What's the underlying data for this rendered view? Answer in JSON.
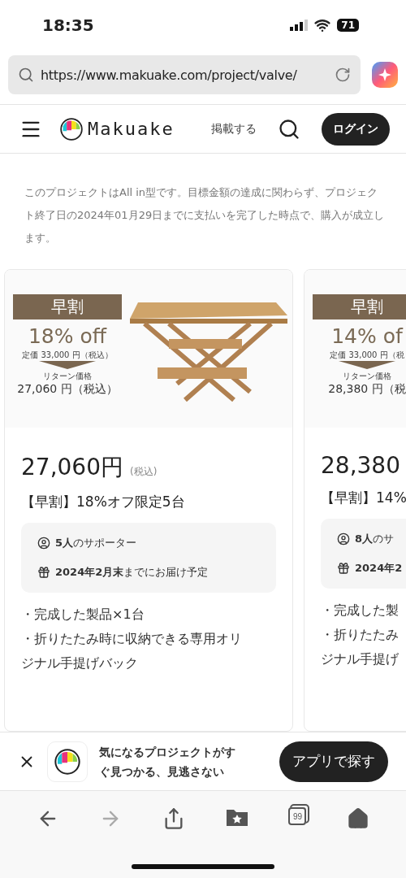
{
  "status_bar": {
    "time": "18:35",
    "battery": "71"
  },
  "address_bar": {
    "url": "https://www.makuake.com/project/valve/"
  },
  "header": {
    "brand": "Makuake",
    "post_link": "掲載する",
    "login_button": "ログイン"
  },
  "notice": "このプロジェクトはAll in型です。目標金額の達成に関わらず、プロジェクト終了日の2024年01月29日までに支払いを完了した時点で、購入が成立します。",
  "rewards": [
    {
      "banner": "早割",
      "discount": "18% off",
      "list_price": "定価 33,000 円（税込）",
      "return_label": "リターン価格",
      "return_price": "27,060 円（税込）",
      "price": "27,060円",
      "tax": "(税込)",
      "title": "【早割】18%オフ限定5台",
      "supporters": "**5人**のサポーター",
      "delivery": "**2024年2月末**までにお届け予定",
      "items": [
        "・完成した製品×1台",
        "・折りたたみ時に収納できる専用オリ",
        "ジナル手提げバック"
      ]
    },
    {
      "banner": "早割",
      "discount": "14% of",
      "list_price": "定価 33,000 円（税",
      "return_label": "リターン価格",
      "return_price": "28,380 円（税",
      "price": "28,380",
      "title": "【早割】14%",
      "supporters": "**8人**のサ",
      "delivery": "**2024年2**",
      "items": [
        "・完成した製",
        "・折りたたみ",
        "ジナル手提げ"
      ]
    }
  ],
  "app_banner": {
    "message": "気になるプロジェクトがすぐ見つかる、見逃さない",
    "button": "アプリで探す"
  },
  "toolbar": [
    {
      "kind": "back",
      "disabled": false
    },
    {
      "kind": "forward",
      "disabled": true
    },
    {
      "kind": "share",
      "disabled": false
    },
    {
      "kind": "bookmarks",
      "disabled": false
    },
    {
      "kind": "tabs",
      "disabled": false,
      "count": "99"
    },
    {
      "kind": "home",
      "disabled": false
    }
  ]
}
